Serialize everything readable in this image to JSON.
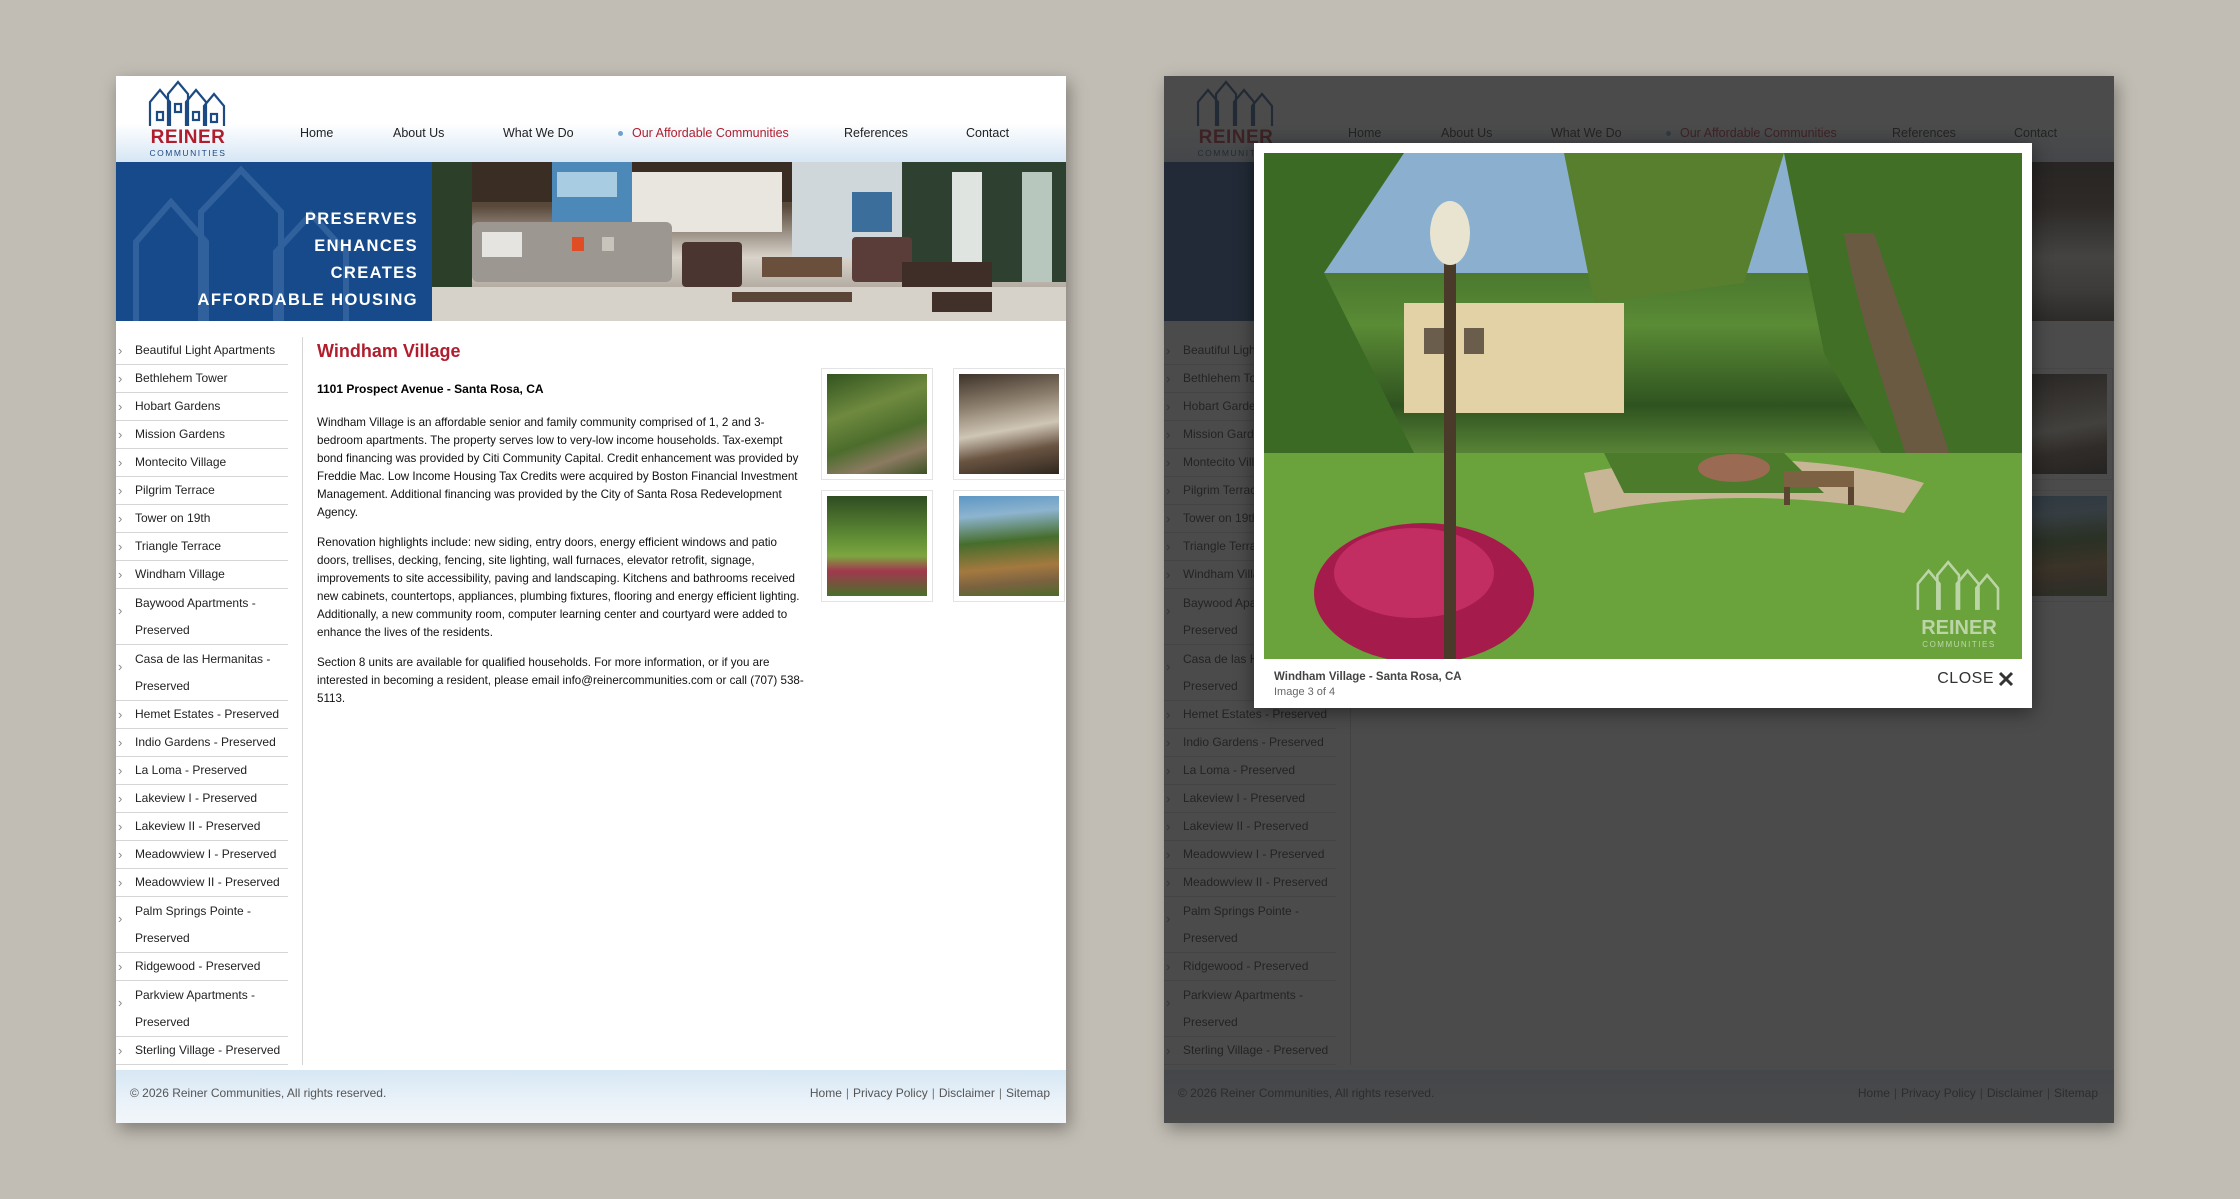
{
  "logo": {
    "name": "REINER",
    "tagline": "COMMUNITIES"
  },
  "nav": [
    {
      "label": "Home",
      "active": false
    },
    {
      "label": "About Us",
      "active": false
    },
    {
      "label": "What We Do",
      "active": false
    },
    {
      "label": "Our Affordable Communities",
      "active": true
    },
    {
      "label": "References",
      "active": false
    },
    {
      "label": "Contact",
      "active": false
    }
  ],
  "banner": {
    "lines": [
      "PRESERVES",
      "ENHANCES",
      "CREATES",
      "AFFORDABLE HOUSING"
    ]
  },
  "sidebar": [
    "Beautiful Light Apartments",
    "Bethlehem Tower",
    "Hobart Gardens",
    "Mission Gardens",
    "Montecito Village",
    "Pilgrim Terrace",
    "Tower on 19th",
    "Triangle Terrace",
    "Windham Village",
    "Baywood Apartments - Preserved",
    "Casa de las Hermanitas - Preserved",
    "Hemet Estates - Preserved",
    "Indio Gardens - Preserved",
    "La Loma - Preserved",
    "Lakeview I - Preserved",
    "Lakeview II - Preserved",
    "Meadowview I - Preserved",
    "Meadowview II - Preserved",
    "Palm Springs Pointe - Preserved",
    "Ridgewood - Preserved",
    "Parkview Apartments - Preserved",
    "Sterling Village - Preserved"
  ],
  "content": {
    "title": "Windham Village",
    "address": "1101 Prospect Avenue - Santa Rosa, CA",
    "paragraphs": [
      "Windham Village is an affordable senior and family community comprised of 1, 2 and 3-bedroom apartments.  The property serves low to very-low income households.  Tax-exempt bond financing was provided by Citi Community Capital.  Credit enhancement was provided by Freddie Mac.  Low Income Housing Tax Credits were acquired by Boston Financial Investment Management.  Additional financing was provided by the City of Santa Rosa Redevelopment Agency.",
      "Renovation highlights include: new siding, entry doors, energy efficient windows and patio doors, trellises, decking, fencing, site lighting, wall furnaces, elevator retrofit, signage, improvements to site accessibility, paving and landscaping.  Kitchens and bathrooms received new cabinets, countertops, appliances, plumbing fixtures, flooring and energy efficient lighting.  Additionally, a new community room, computer learning center and courtyard were added to enhance the lives of the residents.",
      "Section 8 units are available for qualified households.  For more information, or if you are interested in becoming a resident, please email info@reinercommunities.com or call (707) 538-5113."
    ]
  },
  "footer": {
    "copyright": "© 2026 Reiner Communities, All rights reserved.",
    "links": [
      "Home",
      "Privacy Policy",
      "Disclaimer",
      "Sitemap"
    ]
  },
  "lightbox": {
    "caption": "Windham Village - Santa Rosa, CA",
    "counter": "Image 3 of 4",
    "close_label": "CLOSE",
    "watermark": {
      "name": "REINER",
      "tagline": "COMMUNITIES"
    }
  }
}
